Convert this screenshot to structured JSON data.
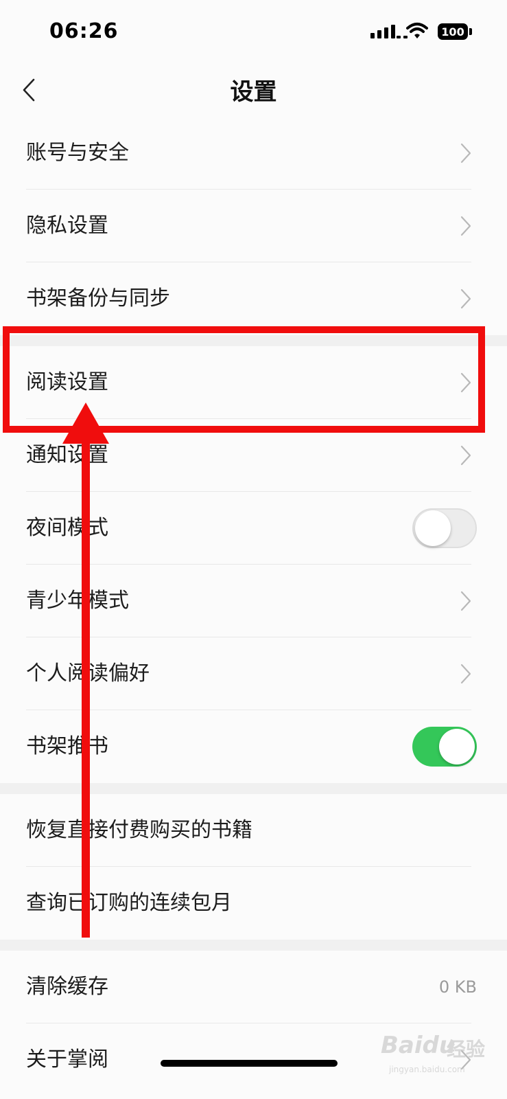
{
  "status_bar": {
    "time": "06:26",
    "battery": "100"
  },
  "header": {
    "title": "设置",
    "back_icon": "chevron-left-icon"
  },
  "groups": [
    {
      "items": [
        {
          "label": "账号与安全",
          "control": "chevron"
        },
        {
          "label": "隐私设置",
          "control": "chevron"
        },
        {
          "label": "书架备份与同步",
          "control": "chevron"
        }
      ]
    },
    {
      "items": [
        {
          "label": "阅读设置",
          "control": "chevron"
        },
        {
          "label": "通知设置",
          "control": "chevron"
        },
        {
          "label": "夜间模式",
          "control": "toggle",
          "toggle_on": false
        },
        {
          "label": "青少年模式",
          "control": "chevron"
        },
        {
          "label": "个人阅读偏好",
          "control": "chevron"
        },
        {
          "label": "书架推书",
          "control": "toggle",
          "toggle_on": true
        }
      ]
    },
    {
      "items": [
        {
          "label": "恢复直接付费购买的书籍",
          "control": "none"
        },
        {
          "label": "查询已订购的连续包月",
          "control": "none"
        }
      ]
    },
    {
      "items": [
        {
          "label": "清除缓存",
          "control": "value",
          "value": "0 KB"
        },
        {
          "label": "关于掌阅",
          "control": "chevron"
        }
      ]
    }
  ],
  "annotation": {
    "highlighted_item": "阅读设置",
    "color": "#f00d0d"
  },
  "colors": {
    "toggle_on": "#34c759",
    "toggle_off": "#ececec",
    "background": "#fbfbfb",
    "divider": "#f0f0f0"
  },
  "watermark": {
    "brand": "Bai",
    "brand2": "du",
    "cn": "经验",
    "url": "jingyan.baidu.com"
  }
}
